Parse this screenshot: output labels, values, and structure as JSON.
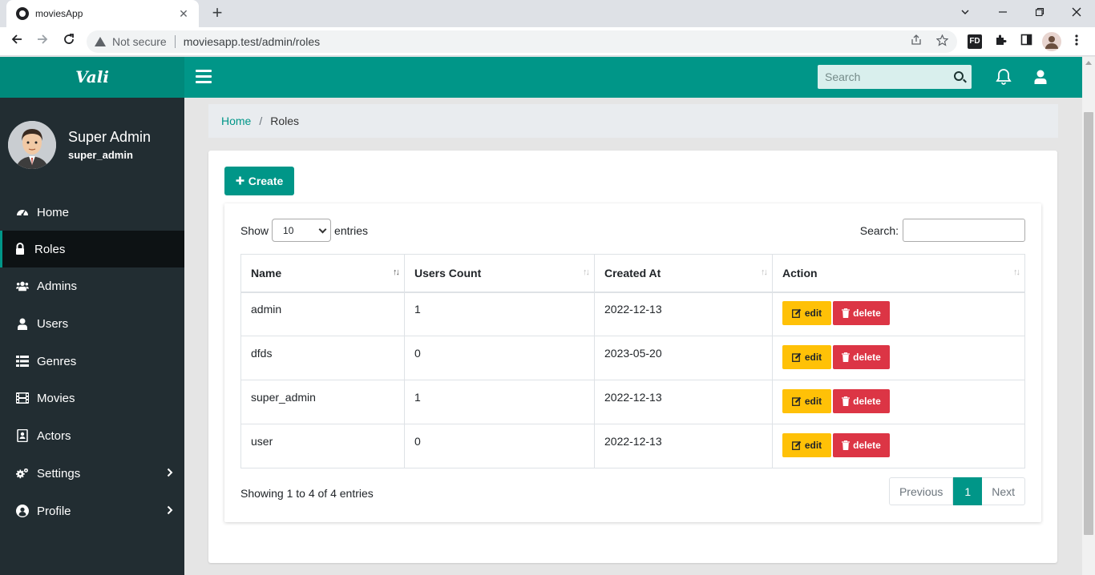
{
  "browser": {
    "tab_title": "moviesApp",
    "tab_close": "✕",
    "new_tab": "+",
    "security_label": "Not secure",
    "url": "moviesapp.test/admin/roles",
    "window_controls": [
      "minimize",
      "restore",
      "close"
    ]
  },
  "header": {
    "logo": "Vali",
    "search_placeholder": "Search",
    "icons": [
      "menu-icon",
      "search-icon",
      "bell-icon",
      "user-icon"
    ]
  },
  "sidebar": {
    "user_name": "Super Admin",
    "user_role": "super_admin",
    "items": [
      {
        "label": "Home",
        "icon": "dashboard-icon",
        "active": false
      },
      {
        "label": "Roles",
        "icon": "lock-icon",
        "active": true
      },
      {
        "label": "Admins",
        "icon": "users-icon",
        "active": false
      },
      {
        "label": "Users",
        "icon": "user-icon",
        "active": false
      },
      {
        "label": "Genres",
        "icon": "list-icon",
        "active": false
      },
      {
        "label": "Movies",
        "icon": "film-icon",
        "active": false
      },
      {
        "label": "Actors",
        "icon": "address-book-icon",
        "active": false
      },
      {
        "label": "Settings",
        "icon": "cogs-icon",
        "active": false,
        "has_children": true
      },
      {
        "label": "Profile",
        "icon": "user-circle-icon",
        "active": false,
        "has_children": true
      }
    ]
  },
  "breadcrumb": {
    "home": "Home",
    "separator": "/",
    "current": "Roles"
  },
  "toolbar": {
    "create_label": "Create"
  },
  "table_controls": {
    "show_label": "Show",
    "entries_label": "entries",
    "page_size": "10",
    "search_label": "Search:"
  },
  "table": {
    "columns": [
      "Name",
      "Users Count",
      "Created At",
      "Action"
    ],
    "rows": [
      {
        "name": "admin",
        "users_count": "1",
        "created_at": "2022-12-13"
      },
      {
        "name": "dfds",
        "users_count": "0",
        "created_at": "2023-05-20"
      },
      {
        "name": "super_admin",
        "users_count": "1",
        "created_at": "2022-12-13"
      },
      {
        "name": "user",
        "users_count": "0",
        "created_at": "2022-12-13"
      }
    ],
    "edit_label": "edit",
    "delete_label": "delete"
  },
  "footer": {
    "info": "Showing 1 to 4 of 4 entries",
    "previous": "Previous",
    "current_page": "1",
    "next": "Next"
  },
  "colors": {
    "primary": "#009688",
    "sidebar_bg": "#222d32",
    "edit": "#ffc107",
    "delete": "#dc3545"
  }
}
